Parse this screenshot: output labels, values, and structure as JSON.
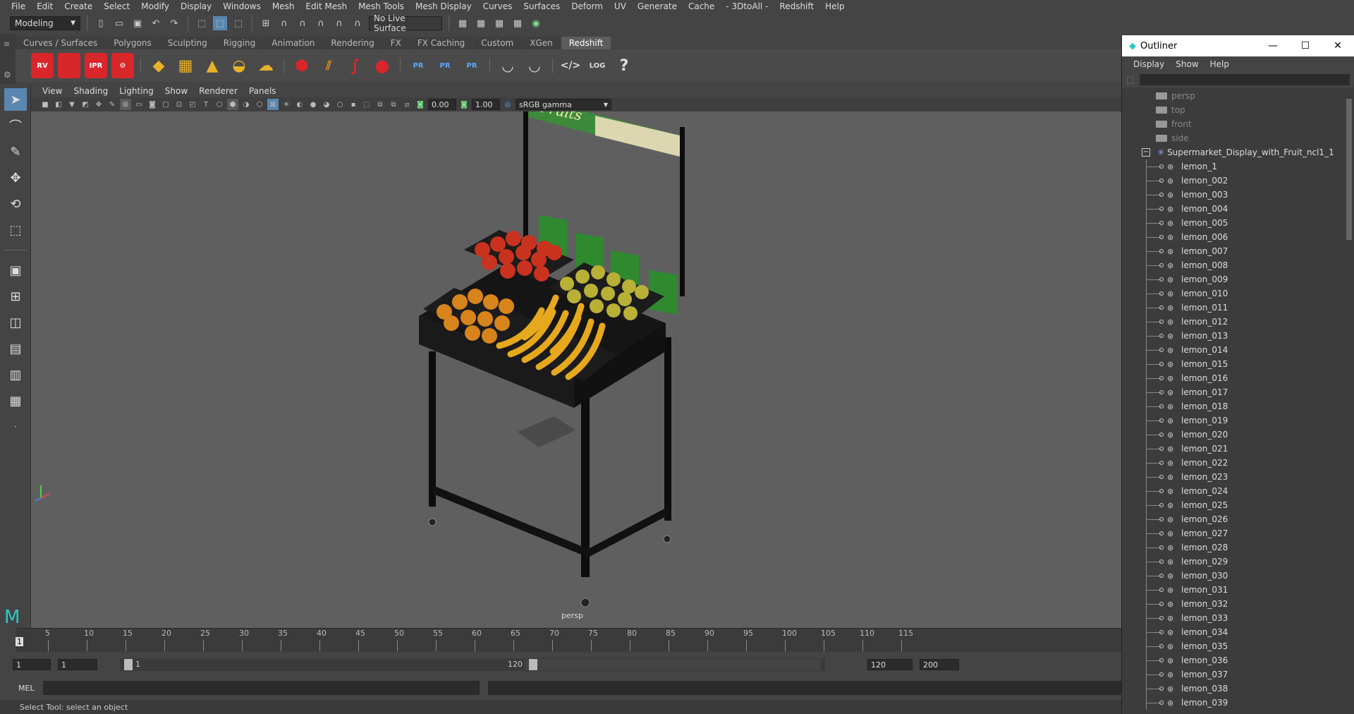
{
  "menubar": {
    "items": [
      "File",
      "Edit",
      "Create",
      "Select",
      "Modify",
      "Display",
      "Windows",
      "Mesh",
      "Edit Mesh",
      "Mesh Tools",
      "Mesh Display",
      "Curves",
      "Surfaces",
      "Deform",
      "UV",
      "Generate",
      "Cache",
      "- 3DtoAll -",
      "Redshift",
      "Help"
    ]
  },
  "status": {
    "mode": "Modeling",
    "live_surface": "No Live Surface"
  },
  "shelf": {
    "tabs": [
      "Curves / Surfaces",
      "Polygons",
      "Sculpting",
      "Rigging",
      "Animation",
      "Rendering",
      "FX",
      "FX Caching",
      "Custom",
      "XGen",
      "Redshift"
    ],
    "active_tab": "Redshift",
    "labels": [
      "RV",
      "IPR",
      "PR",
      "PR",
      "PR",
      "LOG",
      "?"
    ]
  },
  "panel": {
    "menu": [
      "View",
      "Shading",
      "Lighting",
      "Show",
      "Renderer",
      "Panels"
    ],
    "exposure": "0.00",
    "gamma": "1.00",
    "color_space": "sRGB gamma"
  },
  "viewport": {
    "camera_label": "persp",
    "sign_text": "Fruits"
  },
  "timeline": {
    "ticks": [
      "5",
      "10",
      "15",
      "20",
      "25",
      "30",
      "35",
      "40",
      "45",
      "50",
      "55",
      "60",
      "65",
      "70",
      "75",
      "80",
      "85",
      "90",
      "95",
      "100",
      "105",
      "110",
      "115"
    ],
    "current": "1"
  },
  "range": {
    "start": "1",
    "anim_start": "1",
    "range_start": "1",
    "range_end": "120",
    "end": "120",
    "anim_end": "200"
  },
  "cmd": {
    "lang": "MEL"
  },
  "help": {
    "text": "Select Tool: select an object"
  },
  "outliner": {
    "title": "Outliner",
    "menu": [
      "Display",
      "Show",
      "Help"
    ],
    "cameras": [
      "persp",
      "top",
      "front",
      "side"
    ],
    "group": "Supermarket_Display_with_Fruit_ncl1_1",
    "children": [
      "lemon_1",
      "lemon_002",
      "lemon_003",
      "lemon_004",
      "lemon_005",
      "lemon_006",
      "lemon_007",
      "lemon_008",
      "lemon_009",
      "lemon_010",
      "lemon_011",
      "lemon_012",
      "lemon_013",
      "lemon_014",
      "lemon_015",
      "lemon_016",
      "lemon_017",
      "lemon_018",
      "lemon_019",
      "lemon_020",
      "lemon_021",
      "lemon_022",
      "lemon_023",
      "lemon_024",
      "lemon_025",
      "lemon_026",
      "lemon_027",
      "lemon_028",
      "lemon_029",
      "lemon_030",
      "lemon_031",
      "lemon_032",
      "lemon_033",
      "lemon_034",
      "lemon_035",
      "lemon_036",
      "lemon_037",
      "lemon_038",
      "lemon_039"
    ]
  },
  "colors": {
    "accent": "#5a87b0",
    "redshift_red": "#d9262b",
    "viewport_bg": "#5f5f5f"
  }
}
